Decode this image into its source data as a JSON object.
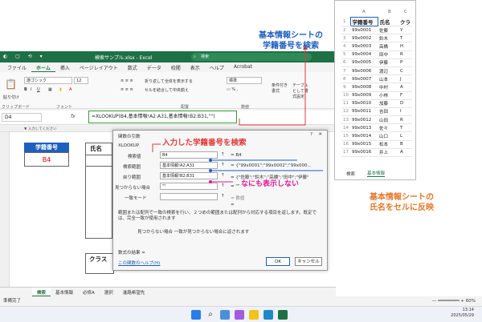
{
  "excel": {
    "filename": "検索サンプル.xlsx",
    "app": "Excel",
    "search_placeholder": "検索",
    "quick_access": "◐ ▢ ⟲ ▾",
    "ribbon_tabs": [
      "ファイル",
      "ホーム",
      "挿入",
      "ページレイアウト",
      "数式",
      "データ",
      "校閲",
      "表示",
      "ヘルプ",
      "Acrobat"
    ],
    "font_name": "游ゴシック",
    "font_size": "12",
    "number_format": "標準",
    "wrap_text": "折り返して全体を表示する",
    "merge_center": "セルを結合して中央揃え",
    "groups": [
      "クリップボード",
      "フォント",
      "配置",
      "数値",
      "スタイル",
      "セル",
      "編集"
    ],
    "paste_label": "貼り付け",
    "cond_format_label": "条件付き書式",
    "table_format_label": "テーブルとして書式設定",
    "insert_label": "挿入",
    "delete_label": "削除",
    "format_label": "書式",
    "sort_label": "並べ替えとフィルター",
    "find_label": "検索と選択",
    "name_box": "D4",
    "fx": "fx",
    "formula": "=XLOOKUP(B4,基本情報!A2:A31,基本情報!B2:B31,\"\")",
    "col_hint": "▼ 入力してください",
    "id_header": "学籍番号",
    "id_value": "B4",
    "name_header": "氏名",
    "class_header": "クラス",
    "sheet_tabs": [
      "検索",
      "基本情報",
      "必修A",
      "選択",
      "進路希望先"
    ],
    "status": "準備完了",
    "zoom": "60%"
  },
  "dialog": {
    "title": "関数の引数",
    "func": "XLOOKUP",
    "labels": [
      "検索値",
      "検索範囲",
      "戻り範囲",
      "見つからない場合",
      "一致モード"
    ],
    "values": [
      "B4",
      "基本情報!A2:A31",
      "基本情報!B2:B31",
      "\"\"",
      ""
    ],
    "results": [
      "= B4",
      "= {\"99x0001\";\"99x0002\";\"99x000...",
      "= {\"佐藤\";\"鈴木\";\"高橋\";\"田中\";\"伊藤\"",
      "= \"\"",
      "= 数値"
    ],
    "eq": "=",
    "description": "範囲または配列で一致の検索を行い、２つめの範囲または配列から対応する項目を返します。既定では、完全一致が使用されます",
    "arg_desc": "見つからない場合 一致が見つからない場合に返されます",
    "result_label": "数式の結果 =",
    "help_link": "この関数のヘルプ(H)",
    "ok": "OK",
    "cancel": "キャンセル"
  },
  "side_sheet": {
    "col_letters": [
      "A",
      "B",
      "C"
    ],
    "headers": [
      "学籍番号",
      "氏名",
      "クラ"
    ],
    "rows": [
      [
        "99x0001",
        "佐藤",
        "Y"
      ],
      [
        "99x0002",
        "鈴木",
        "T"
      ],
      [
        "99x0003",
        "高橋",
        "H"
      ],
      [
        "99x0004",
        "田中",
        "R"
      ],
      [
        "99x0005",
        "伊藤",
        "P"
      ],
      [
        "99x0006",
        "渡辺",
        "C"
      ],
      [
        "99x0007",
        "山本",
        "J"
      ],
      [
        "99x0008",
        "中村",
        "A"
      ],
      [
        "99x0009",
        "小林",
        "F"
      ],
      [
        "99x0010",
        "加藤",
        "D"
      ],
      [
        "99x0011",
        "吉田",
        "I"
      ],
      [
        "99x0012",
        "山田",
        "R"
      ],
      [
        "99x0013",
        "佐々",
        "T"
      ],
      [
        "99x0014",
        "山口",
        "L"
      ],
      [
        "99x0015",
        "松本",
        "B"
      ],
      [
        "99x0016",
        "井上",
        "A"
      ]
    ],
    "tabs": [
      "検索",
      "基本情報"
    ]
  },
  "annotations": {
    "top": "基本情報シートの\n学籍番号を検索",
    "input": "入力した学籍番号を検索",
    "empty": "なにも表示しない",
    "reflect": "基本情報シートの\n氏名をセルに反映"
  },
  "clock": {
    "time": "13:14",
    "date": "2025/05/29"
  },
  "colors": {
    "excel_green": "#1e7145",
    "header_blue": "#1f5fbf",
    "formula_border": "#3a9a3a",
    "callout_blue": "#1f5fbf",
    "callout_orange": "#e3762a",
    "pink": "#e0179a",
    "arrow_red": "#e03a3a"
  }
}
